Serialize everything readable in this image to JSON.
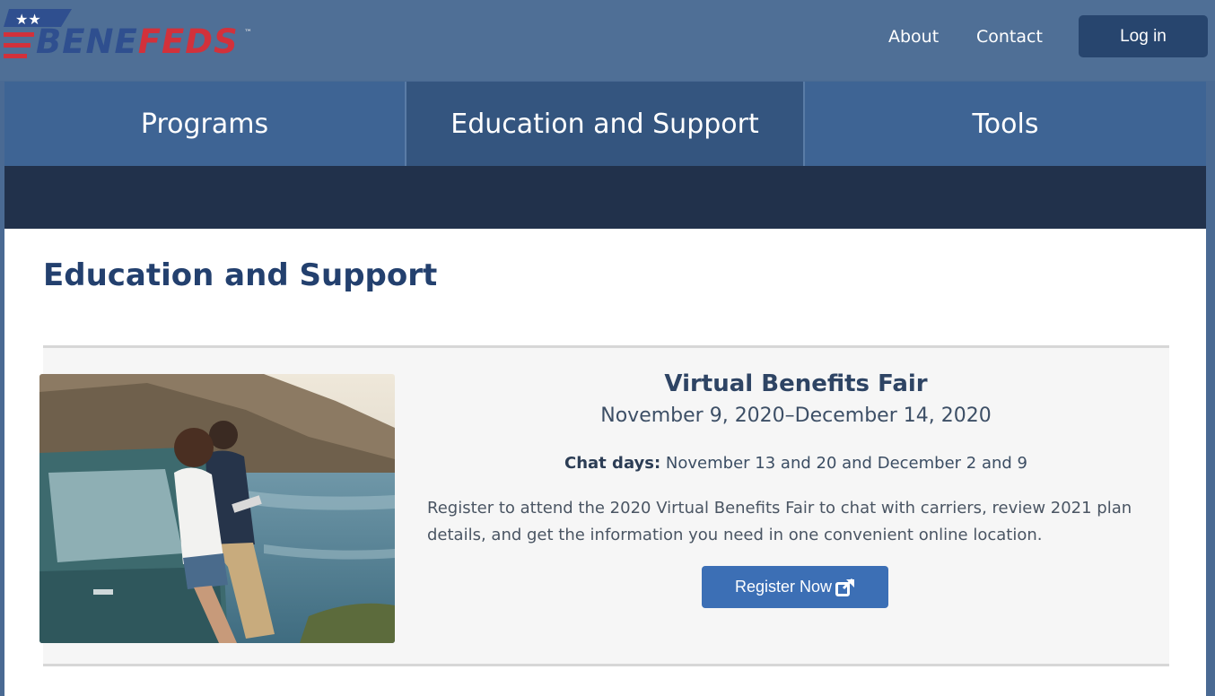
{
  "header": {
    "logo": {
      "part1": "BENE",
      "part2": "FEDS",
      "tm": "™"
    },
    "links": {
      "about": "About",
      "contact": "Contact"
    },
    "login_label": "Log in"
  },
  "nav": {
    "tabs": [
      {
        "label": "Programs"
      },
      {
        "label": "Education and Support"
      },
      {
        "label": "Tools"
      }
    ]
  },
  "page": {
    "title": "Education and Support"
  },
  "event": {
    "title": "Virtual Benefits Fair",
    "dates": "November 9, 2020–December 14, 2020",
    "chat_label": "Chat days:",
    "chat_days": "November 13 and 20 and December 2 and 9",
    "description": "Register to attend the 2020 Virtual Benefits Fair to chat with carriers, review 2021 plan details, and get the information you need in one convenient online location.",
    "register_label": "Register Now"
  },
  "colors": {
    "brand_blue": "#2f4f8f",
    "brand_red": "#d2313b",
    "header_bg": "#4f6f96",
    "nav_bg": "#3e6494",
    "subbar_bg": "#21314b",
    "button_blue": "#3c6fb5"
  },
  "icons": [
    "logo-stars-icon",
    "external-link-icon"
  ]
}
